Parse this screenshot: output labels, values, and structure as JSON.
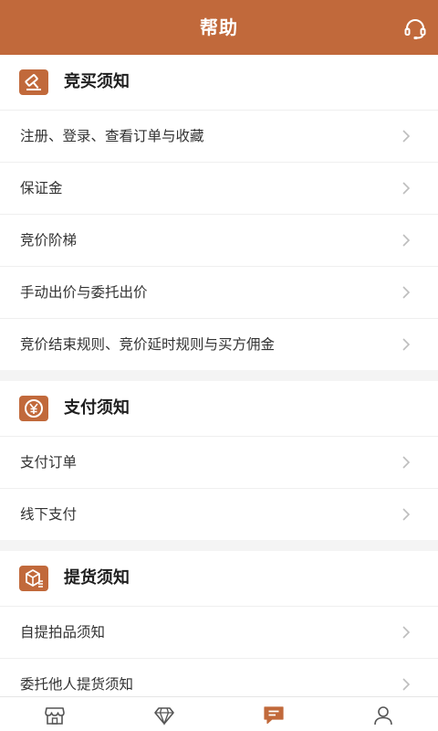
{
  "header": {
    "title": "帮助",
    "service_icon": "headset-icon"
  },
  "sections": [
    {
      "title": "竞买须知",
      "icon": "auction-hammer-icon",
      "items": [
        "注册、登录、查看订单与收藏",
        "保证金",
        "竞价阶梯",
        "手动出价与委托出价",
        "竞价结束规则、竞价延时规则与买方佣金"
      ]
    },
    {
      "title": "支付须知",
      "icon": "yen-coin-icon",
      "items": [
        "支付订单",
        "线下支付"
      ]
    },
    {
      "title": "提货须知",
      "icon": "package-icon",
      "items": [
        "自提拍品须知",
        "委托他人提货须知"
      ]
    }
  ],
  "tabbar": {
    "tabs": [
      {
        "icon": "store-icon",
        "active": false
      },
      {
        "icon": "diamond-icon",
        "active": false
      },
      {
        "icon": "message-icon",
        "active": true
      },
      {
        "icon": "user-icon",
        "active": false
      }
    ]
  },
  "colors": {
    "brand": "#c1693b",
    "section_gap": "#f4f4f4",
    "text": "#333333",
    "inactive_icon": "#555555"
  }
}
